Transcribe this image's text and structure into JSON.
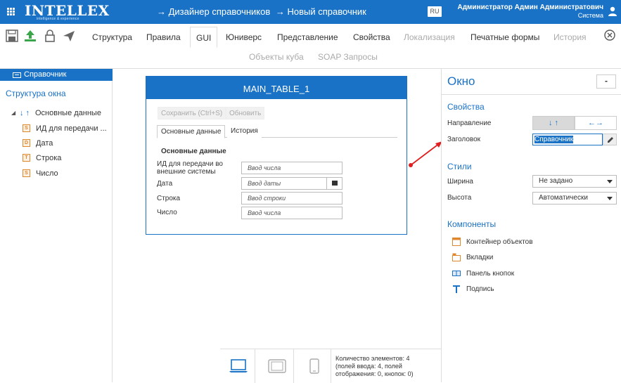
{
  "header": {
    "logo_main": "INTELLEX",
    "logo_tagline": "intelligence & experience",
    "breadcrumb": [
      "→ Дизайнер справочников",
      "→ Новый справочник"
    ],
    "lang": "RU",
    "user_name": "Администратор Админ Администратович",
    "user_role": "Система"
  },
  "toolbar": {
    "tabs": [
      {
        "label": "Структура",
        "state": "normal"
      },
      {
        "label": "Правила",
        "state": "normal"
      },
      {
        "label": "GUI",
        "state": "active"
      },
      {
        "label": "Юниверс",
        "state": "normal"
      },
      {
        "label": "Представление",
        "state": "normal"
      },
      {
        "label": "Свойства",
        "state": "normal"
      },
      {
        "label": "Локализация",
        "state": "disabled"
      },
      {
        "label": "Печатные формы",
        "state": "normal"
      },
      {
        "label": "История",
        "state": "disabled"
      }
    ],
    "tabs_row2": [
      "Объекты куба",
      "SOAP Запросы"
    ]
  },
  "left_panel": {
    "selected_item": "Справочник",
    "structure_title": "Структура окна",
    "tree_root": "Основные данные",
    "tree_children": [
      {
        "label": "ИД для передачи ...",
        "icon": "S"
      },
      {
        "label": "Дата",
        "icon": "D"
      },
      {
        "label": "Строка",
        "icon": "T"
      },
      {
        "label": "Число",
        "icon": "S"
      }
    ]
  },
  "form": {
    "title": "MAIN_TABLE_1",
    "save_button": "Сохранить (Ctrl+S)",
    "refresh_button": "Обновить",
    "tabs": [
      "Основные данные",
      "История"
    ],
    "group_title": "Основные данные",
    "fields": [
      {
        "label_line1": "ИД для передачи во",
        "label_line2": "внешние системы",
        "placeholder": "Ввод числа"
      },
      {
        "label_line1": "Дата",
        "label_line2": "",
        "placeholder": "Ввод даты"
      },
      {
        "label_line1": "Строка",
        "label_line2": "",
        "placeholder": "Ввод строки"
      },
      {
        "label_line1": "Число",
        "label_line2": "",
        "placeholder": "Ввод числа"
      }
    ]
  },
  "bottom_bar": {
    "info_line1": "Количество элементов: 4",
    "info_line2": "(полей ввода: 4, полей",
    "info_line3": "отображения: 0, кнопок: 0)"
  },
  "right_panel": {
    "title": "Окно",
    "collapse_label": "-",
    "properties_title": "Свойства",
    "direction_label": "Направление",
    "direction_vertical": "↓ ↑",
    "direction_horizontal": "←→",
    "caption_label": "Заголовок",
    "caption_value": "Справочник",
    "styles_title": "Стили",
    "width_label": "Ширина",
    "width_value": "Не задано",
    "height_label": "Высота",
    "height_value": "Автоматически",
    "components_title": "Компоненты",
    "components": [
      "Контейнер объектов",
      "Вкладки",
      "Панель кнопок",
      "Подпись"
    ]
  },
  "colors": {
    "accent": "#1a72c6",
    "annotation_arrow": "#e02020"
  }
}
